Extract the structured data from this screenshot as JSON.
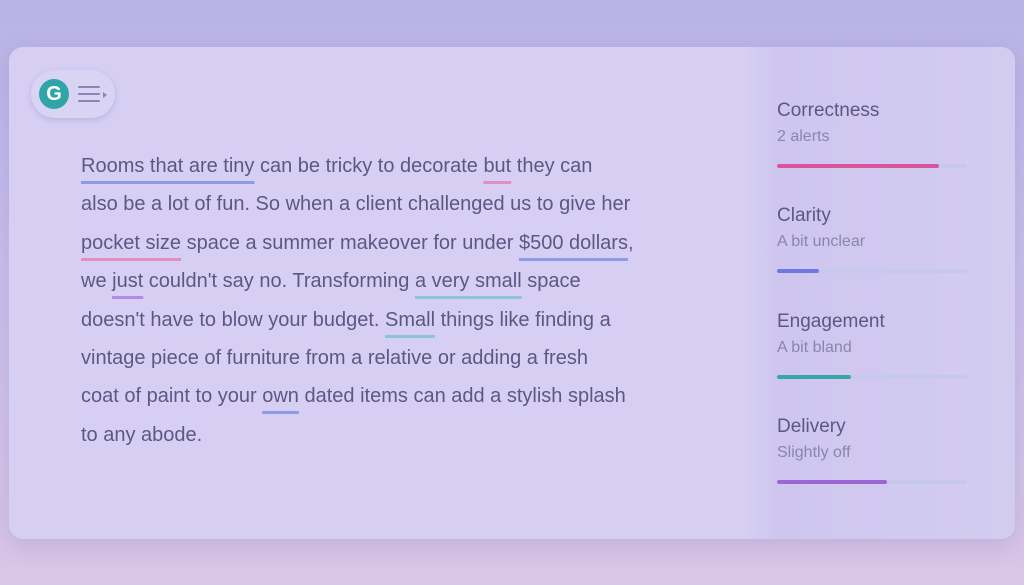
{
  "editor": {
    "lines": [
      [
        {
          "text": "Rooms that are tiny",
          "u": "blue"
        },
        {
          "text": " can be tricky to decorate "
        },
        {
          "text": "but",
          "u": "pink"
        },
        {
          "text": " they can"
        }
      ],
      [
        {
          "text": "also be a lot of fun.  So when a client challenged us to give her"
        }
      ],
      [
        {
          "text": "pocket size",
          "u": "pink"
        },
        {
          "text": " space a summer makeover for under "
        },
        {
          "text": "$500 dollars",
          "u": "blue"
        },
        {
          "text": ","
        }
      ],
      [
        {
          "text": "we "
        },
        {
          "text": "just",
          "u": "purple"
        },
        {
          "text": " couldn't say no. Transforming "
        },
        {
          "text": "a very small",
          "u": "teal"
        },
        {
          "text": " space"
        }
      ],
      [
        {
          "text": "doesn't have to blow your budget. "
        },
        {
          "text": "Small",
          "u": "teal"
        },
        {
          "text": " things like finding a"
        }
      ],
      [
        {
          "text": "vintage piece of furniture from a relative or adding a fresh"
        }
      ],
      [
        {
          "text": "coat of paint to your "
        },
        {
          "text": "own",
          "u": "blue"
        },
        {
          "text": " dated items can add a stylish splash"
        }
      ],
      [
        {
          "text": "to any abode."
        }
      ]
    ]
  },
  "metrics": [
    {
      "name": "Correctness",
      "status": "2 alerts",
      "fill": 0.85,
      "color": "#d9549a"
    },
    {
      "name": "Clarity",
      "status": "A bit unclear",
      "fill": 0.22,
      "color": "#6d79e0"
    },
    {
      "name": "Engagement",
      "status": "A bit bland",
      "fill": 0.39,
      "color": "#3aa5a9"
    },
    {
      "name": "Delivery",
      "status": "Slightly off",
      "fill": 0.58,
      "color": "#9c65d4"
    }
  ]
}
